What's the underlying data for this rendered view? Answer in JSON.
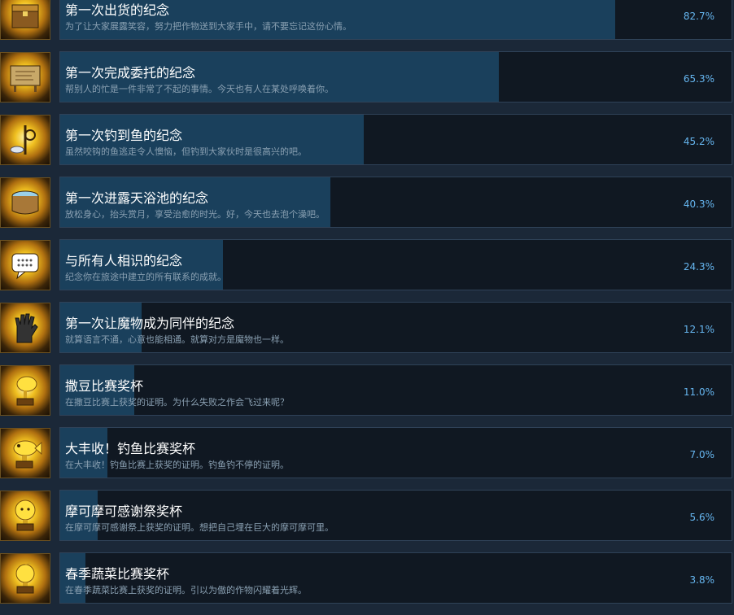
{
  "colors": {
    "background": "#1b2838",
    "panel": "#101822",
    "progress_fill": "#1a405c",
    "percent_text": "#66b6f0",
    "icon_gold": "#f0c020"
  },
  "achievements": [
    {
      "title": "第一次出货的纪念",
      "description": "为了让大家展露笑容，努力把作物送到大家手中，请不要忘记这份心情。",
      "percent": "82.7%",
      "progress": 82.7,
      "icon": "shipping-chest-icon"
    },
    {
      "title": "第一次完成委托的纪念",
      "description": "帮别人的忙是一件非常了不起的事情。今天也有人在某处呼唤着你。",
      "percent": "65.3%",
      "progress": 65.3,
      "icon": "request-board-icon"
    },
    {
      "title": "第一次钓到鱼的纪念",
      "description": "虽然咬钩的鱼逃走令人懊恼，但钓到大家伙时是很高兴的吧。",
      "percent": "45.2%",
      "progress": 45.2,
      "icon": "fishing-rod-icon"
    },
    {
      "title": "第一次进露天浴池的纪念",
      "description": "放松身心，抬头赏月，享受治愈的时光。好，今天也去泡个澡吧。",
      "percent": "40.3%",
      "progress": 40.3,
      "icon": "bathtub-icon"
    },
    {
      "title": "与所有人相识的纪念",
      "description": "纪念你在旅途中建立的所有联系的成就。",
      "percent": "24.3%",
      "progress": 24.3,
      "icon": "speech-bubble-icon"
    },
    {
      "title": "第一次让魔物成为同伴的纪念",
      "description": "就算语言不通，心意也能相通。就算对方是魔物也一样。",
      "percent": "12.1%",
      "progress": 12.1,
      "icon": "glove-icon"
    },
    {
      "title": "撒豆比赛奖杯",
      "description": "在撒豆比赛上获奖的证明。为什么失败之作会飞过来呢？",
      "percent": "11.0%",
      "progress": 11.0,
      "icon": "bean-trophy-icon"
    },
    {
      "title": "大丰收！钓鱼比赛奖杯",
      "description": "在大丰收！钓鱼比赛上获奖的证明。钓鱼钓不停的证明。",
      "percent": "7.0%",
      "progress": 7.0,
      "icon": "fish-trophy-icon"
    },
    {
      "title": "摩可摩可感谢祭奖杯",
      "description": "在摩可摩可感谢祭上获奖的证明。想把自己埋在巨大的摩可摩可里。",
      "percent": "5.6%",
      "progress": 5.6,
      "icon": "sheep-trophy-icon"
    },
    {
      "title": "春季蔬菜比赛奖杯",
      "description": "在春季蔬菜比赛上获奖的证明。引以为傲的作物闪耀着光辉。",
      "percent": "3.8%",
      "progress": 3.8,
      "icon": "vegetable-trophy-icon"
    }
  ]
}
